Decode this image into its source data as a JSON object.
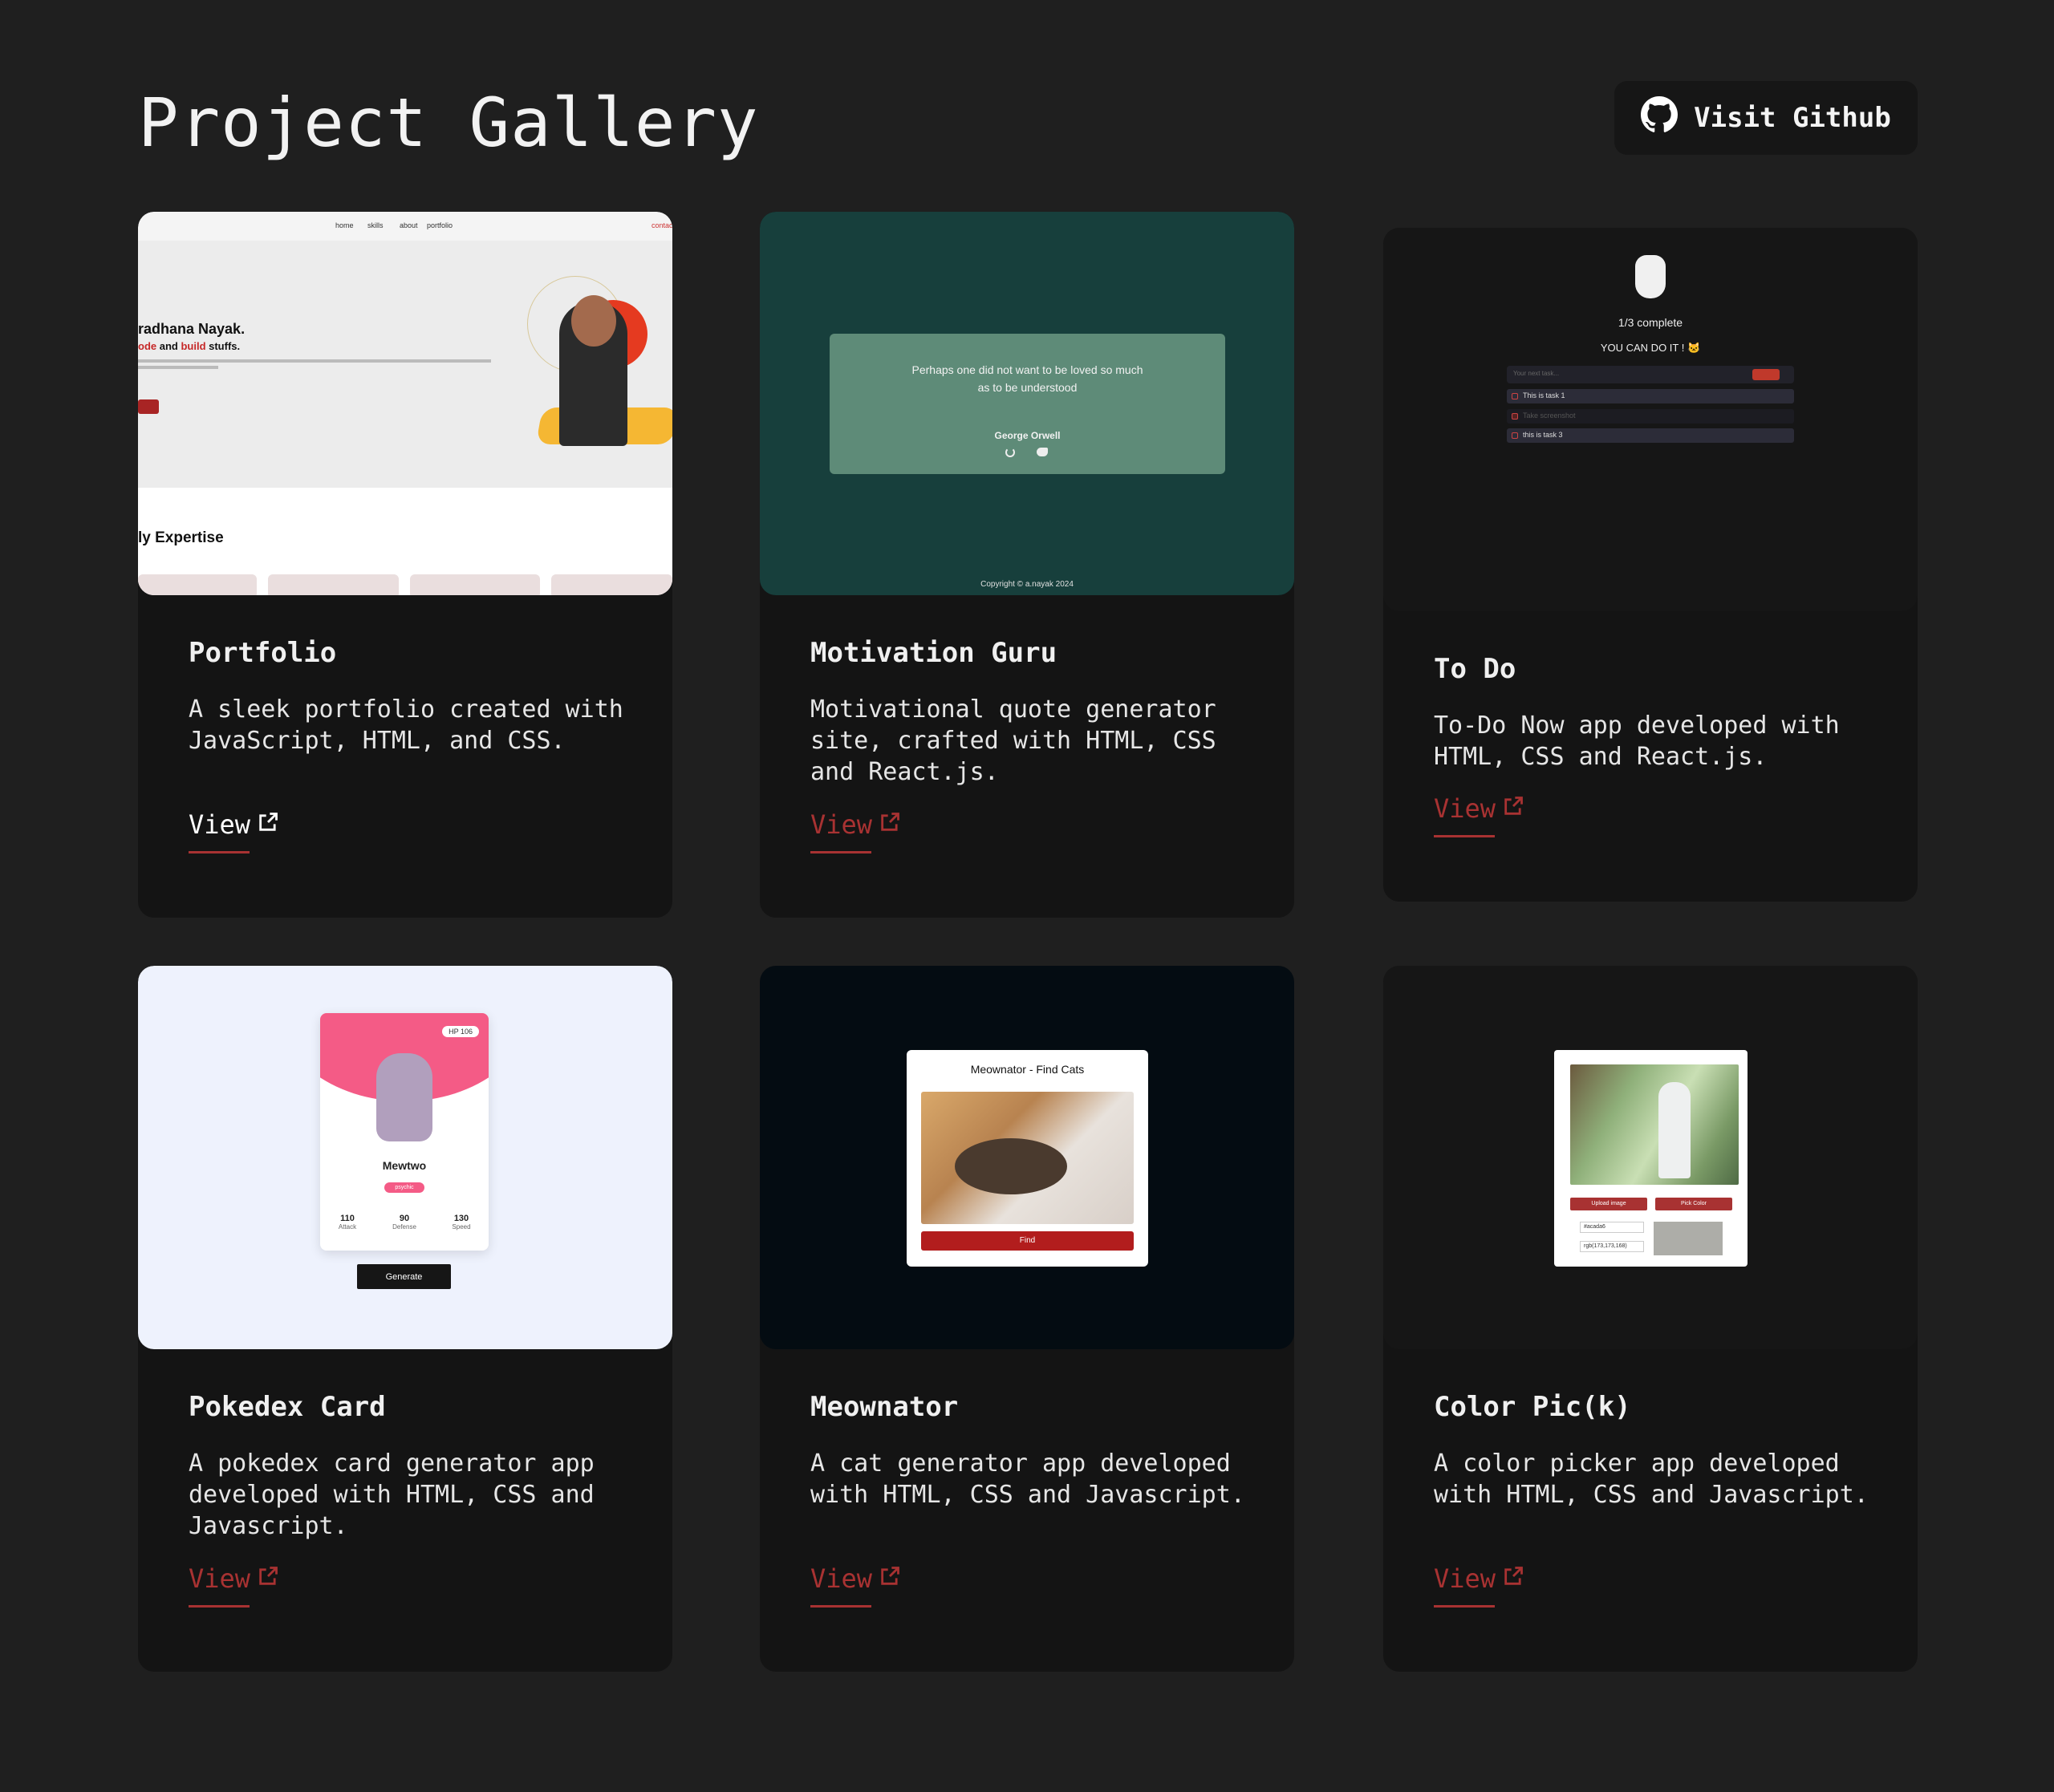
{
  "header": {
    "title": "Project Gallery",
    "github_label": "Visit Github"
  },
  "colors": {
    "background": "#1f1f1f",
    "card": "#141414",
    "accent": "#a83232"
  },
  "projects": [
    {
      "title": "Portfolio",
      "description": "A sleek portfolio created with JavaScript, HTML, and CSS.",
      "link_label": "View",
      "preview": {
        "nav": [
          "home",
          "skills",
          "about",
          "portfolio",
          "contact"
        ],
        "name": "radhana Nayak.",
        "tagline_a": "ode",
        "tagline_b": " and ",
        "tagline_c": "build",
        "tagline_d": " stuffs.",
        "section": "ly Expertise"
      }
    },
    {
      "title": "Motivation Guru",
      "description": "Motivational quote generator site, crafted with HTML, CSS and React.js.",
      "link_label": "View",
      "preview": {
        "quote_line1": "Perhaps one did not want to be loved so much",
        "quote_line2": "as to be understood",
        "author": "George Orwell",
        "copyright": "Copyright © a.nayak 2024"
      }
    },
    {
      "title": "To Do",
      "description": "To-Do Now app developed with HTML, CSS and React.js.",
      "link_label": "View",
      "preview": {
        "progress": "1/3 complete",
        "cheer": "YOU CAN DO IT ! 🐱",
        "placeholder": "Your next task...",
        "tasks": [
          "This is task 1",
          "Take screenshot",
          "this is task 3"
        ]
      }
    },
    {
      "title": "Pokedex Card",
      "description": "A pokedex card generator app developed with HTML, CSS and Javascript.",
      "link_label": "View",
      "preview": {
        "hp": "HP 106",
        "name": "Mewtwo",
        "type": "psychic",
        "stats": [
          {
            "value": "110",
            "label": "Attack"
          },
          {
            "value": "90",
            "label": "Defense"
          },
          {
            "value": "130",
            "label": "Speed"
          }
        ],
        "button": "Generate"
      }
    },
    {
      "title": "Meownator",
      "description": "A cat generator app developed with HTML, CSS and Javascript.",
      "link_label": "View",
      "preview": {
        "heading": "Meownator - Find Cats",
        "button": "Find"
      }
    },
    {
      "title": "Color Pic(k)",
      "description": "A color picker app developed with HTML, CSS and Javascript.",
      "link_label": "View",
      "preview": {
        "upload": "Upload image",
        "pick": "Pick Color",
        "hex": "#acada6",
        "rgb": "rgb(173,173,168)"
      }
    }
  ]
}
